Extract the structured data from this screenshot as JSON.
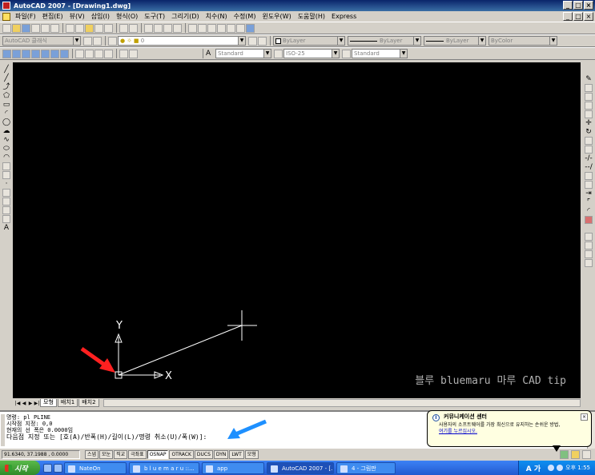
{
  "window": {
    "title": "AutoCAD 2007 - [Drawing1.dwg]",
    "buttons": [
      "_",
      "□",
      "×"
    ]
  },
  "menu": {
    "items": [
      "파일(F)",
      "편집(E)",
      "뷰(V)",
      "삽입(I)",
      "형식(O)",
      "도구(T)",
      "그리기(D)",
      "치수(N)",
      "수정(M)",
      "윈도우(W)",
      "도움말(H)",
      "Express"
    ],
    "doc_buttons": [
      "_",
      "□",
      "×"
    ]
  },
  "toolbars": {
    "workspace": "AutoCAD 클래식",
    "layer": "0",
    "color": "ByLayer",
    "linetype": "ByLayer",
    "lineweight": "ByLayer",
    "plotstyle": "ByColor",
    "text_style": "Standard",
    "dim_style": "ISO-25",
    "table_style": "Standard"
  },
  "drawing": {
    "ucs_y": "Y",
    "ucs_x": "X",
    "watermark": "블루 bluemaru 마루 CAD tip",
    "colors": {
      "background": "#000000",
      "line": "#ffffff",
      "arrow_red": "#ff2020",
      "arrow_blue": "#1e90ff"
    }
  },
  "tabs": {
    "nav": [
      "|◀",
      "◀",
      "▶",
      "▶|"
    ],
    "items": [
      "모형",
      "배치1",
      "배치2"
    ]
  },
  "command": {
    "lines": [
      "명령: pl PLINE",
      "시작점 지정: 0,0",
      "현재의 선 폭은 0.0000임"
    ],
    "prompt": "다음점 지정 또는 [호(A)/반폭(H)/길이(L)/명령 취소(U)/폭(W)]:"
  },
  "balloon": {
    "title": "커뮤니케이션 센터",
    "body": "사용자의 소프트웨어를 가장 최신으로 유지하는 손쉬운 방법,",
    "link": "여기를 누르십시오.",
    "close": "×"
  },
  "status": {
    "coords": "91.6340, 37.1988 , 0.0000",
    "buttons": [
      "스냅",
      "모눈",
      "직교",
      "극좌표",
      "OSNAP",
      "OTRACK",
      "DUCS",
      "DYN",
      "LWT",
      "모형"
    ],
    "active": [
      "OSNAP"
    ]
  },
  "taskbar": {
    "start": "시작",
    "tasks": [
      "NateOn",
      "b l u e m a r u ::...",
      "app",
      "AutoCAD 2007 - [...",
      "4 - 그림판"
    ],
    "ime": "A 가",
    "clock": "오후 1:55"
  }
}
